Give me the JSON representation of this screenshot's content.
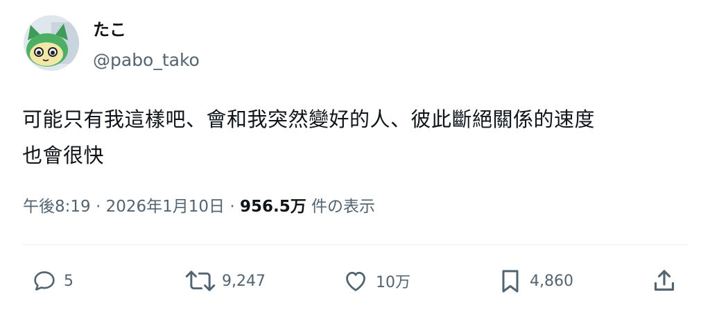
{
  "user": {
    "display_name": "たこ",
    "handle": "@pabo_tako",
    "avatar_icon": "frog-character-icon"
  },
  "post": {
    "line1": "可能只有我這樣吧、會和我突然變好的人、彼此斷絕關係的速度",
    "line2": "也會很快",
    "time": "午後8:19",
    "sep": "·",
    "date": "2026年1月10日",
    "views_count": "956.5万",
    "views_label": "件の表示"
  },
  "actions": {
    "reply_count": "5",
    "repost_count": "9,247",
    "like_count": "10万",
    "bookmark_count": "4,860"
  },
  "colors": {
    "text": "#0f1419",
    "secondary": "#536471",
    "divider": "#eff3f4"
  }
}
